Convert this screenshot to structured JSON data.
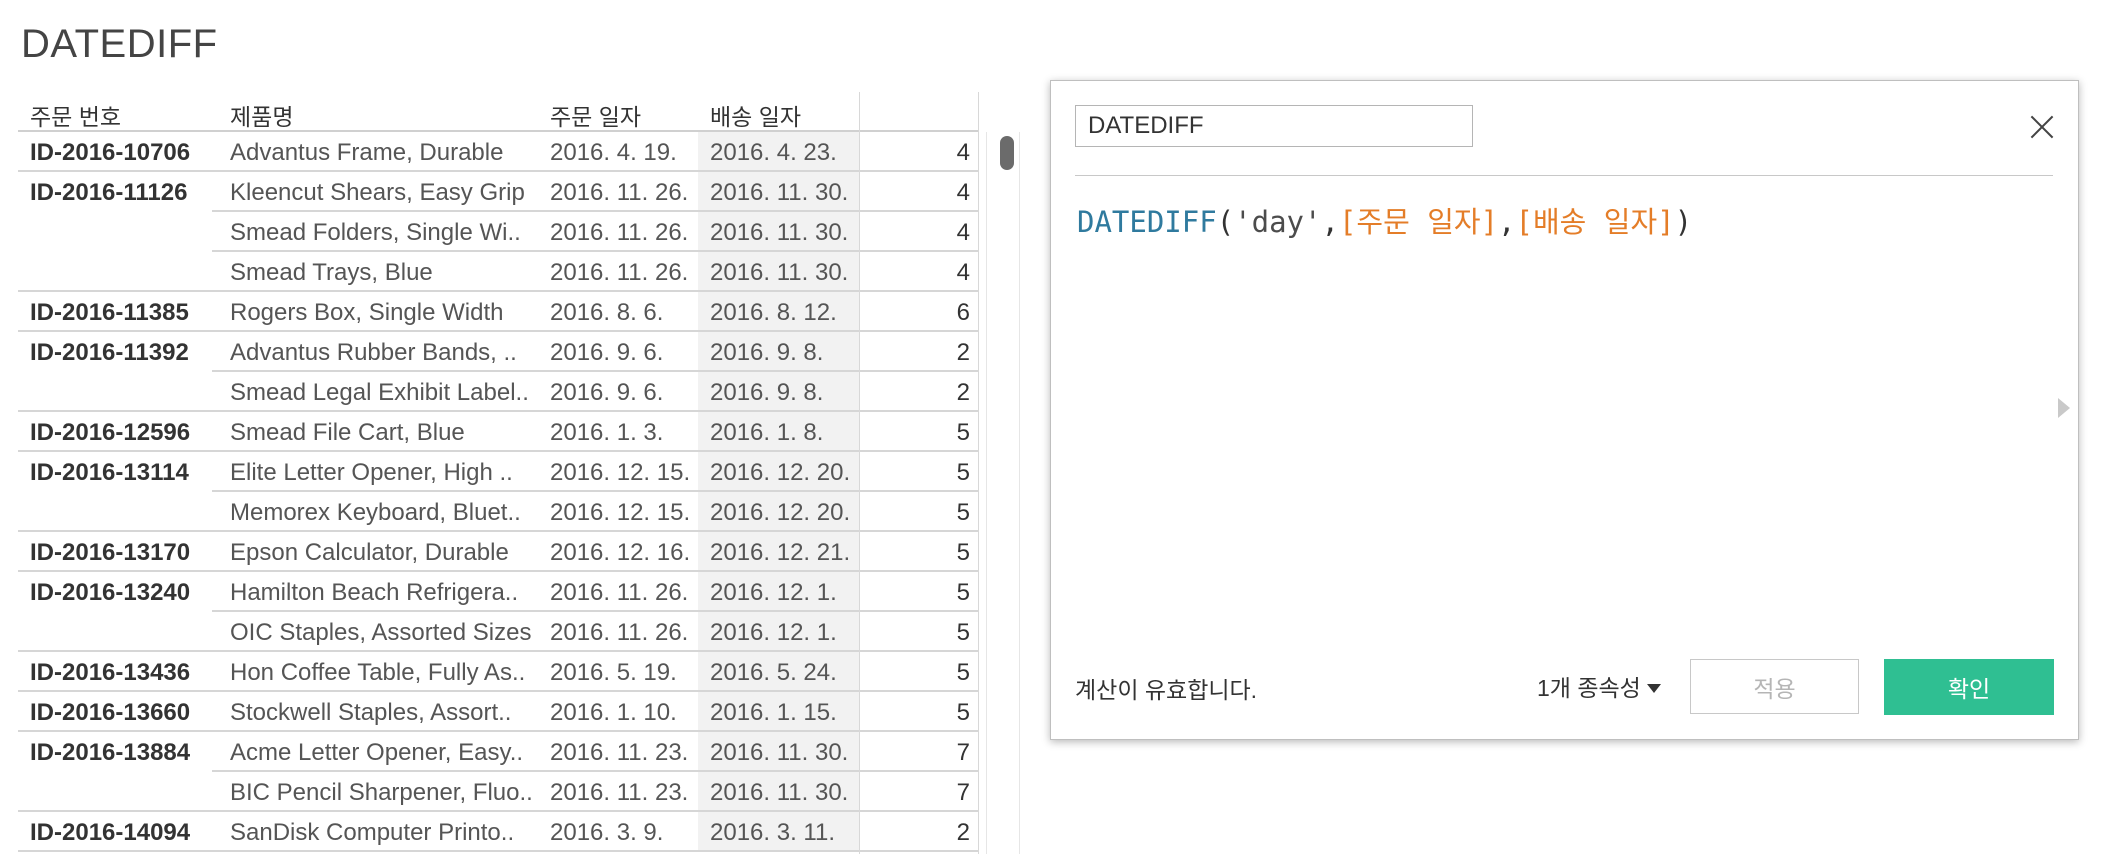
{
  "sheet": {
    "title": "DATEDIFF"
  },
  "table": {
    "headers": [
      "주문 번호",
      "제품명",
      "주문 일자",
      "배송 일자",
      ""
    ],
    "rows": [
      {
        "order_id": "ID-2016-10706",
        "product": "Advantus Frame, Durable",
        "order_date": "2016. 4. 19.",
        "ship_date": "2016. 4. 23.",
        "value": "4"
      },
      {
        "order_id": "ID-2016-11126",
        "product": "Kleencut Shears, Easy Grip",
        "order_date": "2016. 11. 26.",
        "ship_date": "2016. 11. 30.",
        "value": "4"
      },
      {
        "order_id": "",
        "product": "Smead Folders, Single Wi..",
        "order_date": "2016. 11. 26.",
        "ship_date": "2016. 11. 30.",
        "value": "4"
      },
      {
        "order_id": "",
        "product": "Smead Trays, Blue",
        "order_date": "2016. 11. 26.",
        "ship_date": "2016. 11. 30.",
        "value": "4"
      },
      {
        "order_id": "ID-2016-11385",
        "product": "Rogers Box, Single Width",
        "order_date": "2016. 8. 6.",
        "ship_date": "2016. 8. 12.",
        "value": "6"
      },
      {
        "order_id": "ID-2016-11392",
        "product": "Advantus Rubber Bands, ..",
        "order_date": "2016. 9. 6.",
        "ship_date": "2016. 9. 8.",
        "value": "2"
      },
      {
        "order_id": "",
        "product": "Smead Legal Exhibit Label..",
        "order_date": "2016. 9. 6.",
        "ship_date": "2016. 9. 8.",
        "value": "2"
      },
      {
        "order_id": "ID-2016-12596",
        "product": "Smead File Cart, Blue",
        "order_date": "2016. 1. 3.",
        "ship_date": "2016. 1. 8.",
        "value": "5"
      },
      {
        "order_id": "ID-2016-13114",
        "product": "Elite Letter Opener, High ..",
        "order_date": "2016. 12. 15.",
        "ship_date": "2016. 12. 20.",
        "value": "5"
      },
      {
        "order_id": "",
        "product": "Memorex Keyboard, Bluet..",
        "order_date": "2016. 12. 15.",
        "ship_date": "2016. 12. 20.",
        "value": "5"
      },
      {
        "order_id": "ID-2016-13170",
        "product": "Epson Calculator, Durable",
        "order_date": "2016. 12. 16.",
        "ship_date": "2016. 12. 21.",
        "value": "5"
      },
      {
        "order_id": "ID-2016-13240",
        "product": "Hamilton Beach Refrigera..",
        "order_date": "2016. 11. 26.",
        "ship_date": "2016. 12. 1.",
        "value": "5"
      },
      {
        "order_id": "",
        "product": "OIC Staples, Assorted Sizes",
        "order_date": "2016. 11. 26.",
        "ship_date": "2016. 12. 1.",
        "value": "5"
      },
      {
        "order_id": "ID-2016-13436",
        "product": "Hon Coffee Table, Fully As..",
        "order_date": "2016. 5. 19.",
        "ship_date": "2016. 5. 24.",
        "value": "5"
      },
      {
        "order_id": "ID-2016-13660",
        "product": "Stockwell Staples, Assort..",
        "order_date": "2016. 1. 10.",
        "ship_date": "2016. 1. 15.",
        "value": "5"
      },
      {
        "order_id": "ID-2016-13884",
        "product": "Acme Letter Opener, Easy..",
        "order_date": "2016. 11. 23.",
        "ship_date": "2016. 11. 30.",
        "value": "7"
      },
      {
        "order_id": "",
        "product": "BIC Pencil Sharpener, Fluo..",
        "order_date": "2016. 11. 23.",
        "ship_date": "2016. 11. 30.",
        "value": "7"
      },
      {
        "order_id": "ID-2016-14094",
        "product": "SanDisk Computer Printo..",
        "order_date": "2016. 3. 9.",
        "ship_date": "2016. 3. 11.",
        "value": "2"
      }
    ]
  },
  "dialog": {
    "name_value": "DATEDIFF",
    "formula_tokens": [
      {
        "text": "DATEDIFF",
        "kind": "func"
      },
      {
        "text": "(",
        "kind": "punc"
      },
      {
        "text": "'day'",
        "kind": "str"
      },
      {
        "text": ",",
        "kind": "punc"
      },
      {
        "text": "[주문 일자]",
        "kind": "field"
      },
      {
        "text": ",",
        "kind": "punc"
      },
      {
        "text": "[배송 일자]",
        "kind": "field"
      },
      {
        "text": ")",
        "kind": "punc"
      }
    ],
    "status_text": "계산이 유효합니다.",
    "dependencies_label": "1개 종속성",
    "apply_label": "적용",
    "ok_label": "확인",
    "close_icon": "close-icon"
  },
  "colors": {
    "function": "#2f7a9e",
    "field": "#e47d28",
    "ok_button": "#2fbf92"
  }
}
